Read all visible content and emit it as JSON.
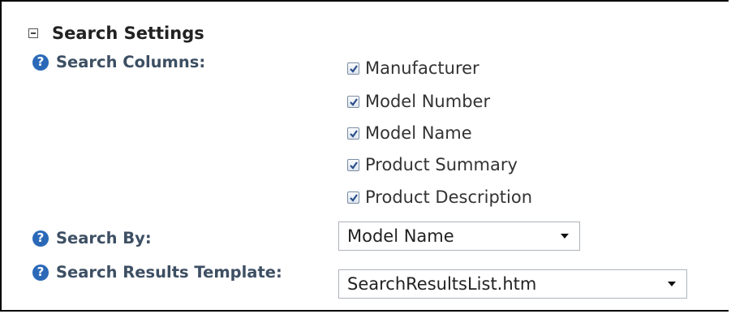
{
  "section": {
    "title": "Search Settings"
  },
  "settings": {
    "search_columns": {
      "label": "Search Columns:",
      "options": [
        {
          "label": "Manufacturer",
          "checked": true
        },
        {
          "label": "Model Number",
          "checked": true
        },
        {
          "label": "Model Name",
          "checked": true
        },
        {
          "label": "Product Summary",
          "checked": true
        },
        {
          "label": "Product Description",
          "checked": true
        }
      ]
    },
    "search_by": {
      "label": "Search By:",
      "value": "Model Name"
    },
    "search_results_template": {
      "label": "Search Results Template:",
      "value": "SearchResultsList.htm"
    }
  },
  "icons": {
    "help": "help-icon",
    "collapse": "collapse-minus-icon",
    "dropdown": "chevron-down-icon",
    "check": "checkmark-icon"
  },
  "colors": {
    "label": "#3d4f63",
    "help_icon": "#2b69b8",
    "checkmark": "#2b4f8a"
  }
}
